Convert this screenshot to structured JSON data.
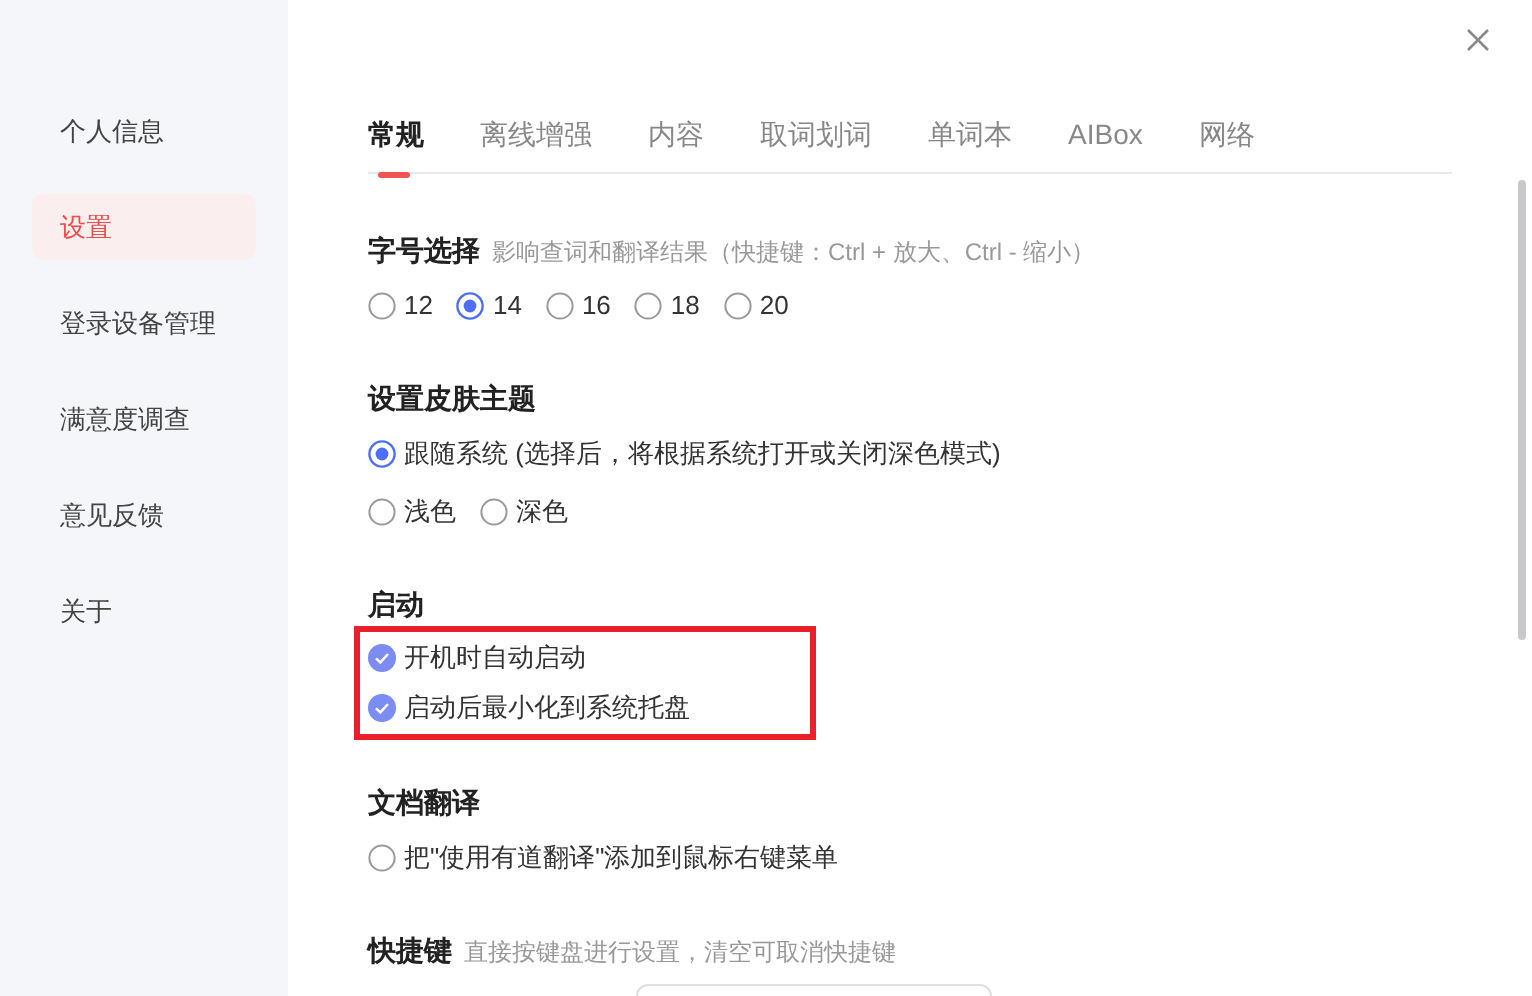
{
  "sidebar": {
    "items": [
      {
        "label": "个人信息",
        "selected": false
      },
      {
        "label": "设置",
        "selected": true
      },
      {
        "label": "登录设备管理",
        "selected": false
      },
      {
        "label": "满意度调查",
        "selected": false
      },
      {
        "label": "意见反馈",
        "selected": false
      },
      {
        "label": "关于",
        "selected": false
      }
    ]
  },
  "tabs": [
    {
      "label": "常规",
      "selected": true
    },
    {
      "label": "离线增强",
      "selected": false
    },
    {
      "label": "内容",
      "selected": false
    },
    {
      "label": "取词划词",
      "selected": false
    },
    {
      "label": "单词本",
      "selected": false
    },
    {
      "label": "AIBox",
      "selected": false
    },
    {
      "label": "网络",
      "selected": false
    }
  ],
  "sections": [
    {
      "title": "字号选择",
      "hint": "影响查词和翻译结果（快捷键：Ctrl + 放大、Ctrl - 缩小）",
      "highlighted": false,
      "rows": [
        [
          {
            "kind": "radio",
            "label": "12",
            "selected": false
          },
          {
            "kind": "radio",
            "label": "14",
            "selected": true
          },
          {
            "kind": "radio",
            "label": "16",
            "selected": false
          },
          {
            "kind": "radio",
            "label": "18",
            "selected": false
          },
          {
            "kind": "radio",
            "label": "20",
            "selected": false
          }
        ]
      ]
    },
    {
      "title": "设置皮肤主题",
      "highlighted": false,
      "rows": [
        [
          {
            "kind": "radio",
            "label": "跟随系统 (选择后，将根据系统打开或关闭深色模式)",
            "selected": true
          }
        ],
        [
          {
            "kind": "radio",
            "label": "浅色",
            "selected": false
          },
          {
            "kind": "radio",
            "label": "深色",
            "selected": false
          }
        ]
      ]
    },
    {
      "title": "启动",
      "highlighted": true,
      "rows": [
        [
          {
            "kind": "check",
            "label": "开机时自动启动",
            "checked": true
          }
        ],
        [
          {
            "kind": "check",
            "label": "启动后最小化到系统托盘",
            "checked": true
          }
        ]
      ]
    },
    {
      "title": "文档翻译",
      "highlighted": false,
      "rows": [
        [
          {
            "kind": "radio",
            "label": "把\"使用有道翻译\"添加到鼠标右键菜单",
            "selected": false
          }
        ]
      ]
    },
    {
      "title": "快捷键",
      "hint": "直接按键盘进行设置，清空可取消快捷键"
    }
  ]
}
